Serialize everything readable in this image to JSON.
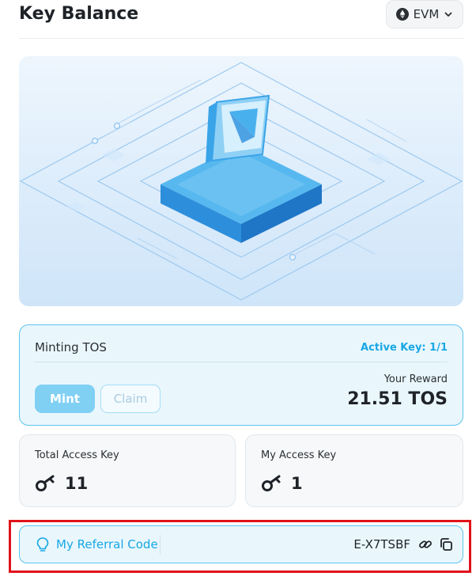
{
  "header": {
    "title": "Key Balance",
    "network_label": "EVM",
    "network_icon": "ethereum-icon"
  },
  "minting": {
    "title": "Minting TOS",
    "active_key_label": "Active Key: 1/1",
    "reward_label": "Your Reward",
    "reward_value": "21.51 TOS",
    "mint_label": "Mint",
    "claim_label": "Claim"
  },
  "stats": {
    "total_label": "Total Access Key",
    "total_value": "11",
    "mine_label": "My Access Key",
    "mine_value": "1",
    "icon": "key-icon"
  },
  "referral": {
    "label": "My Referral Code",
    "code": "E-X7TSBF"
  },
  "colors": {
    "accent": "#18a7e3",
    "highlight_border": "#e0131b",
    "mint_button": "#7fd0f3"
  }
}
